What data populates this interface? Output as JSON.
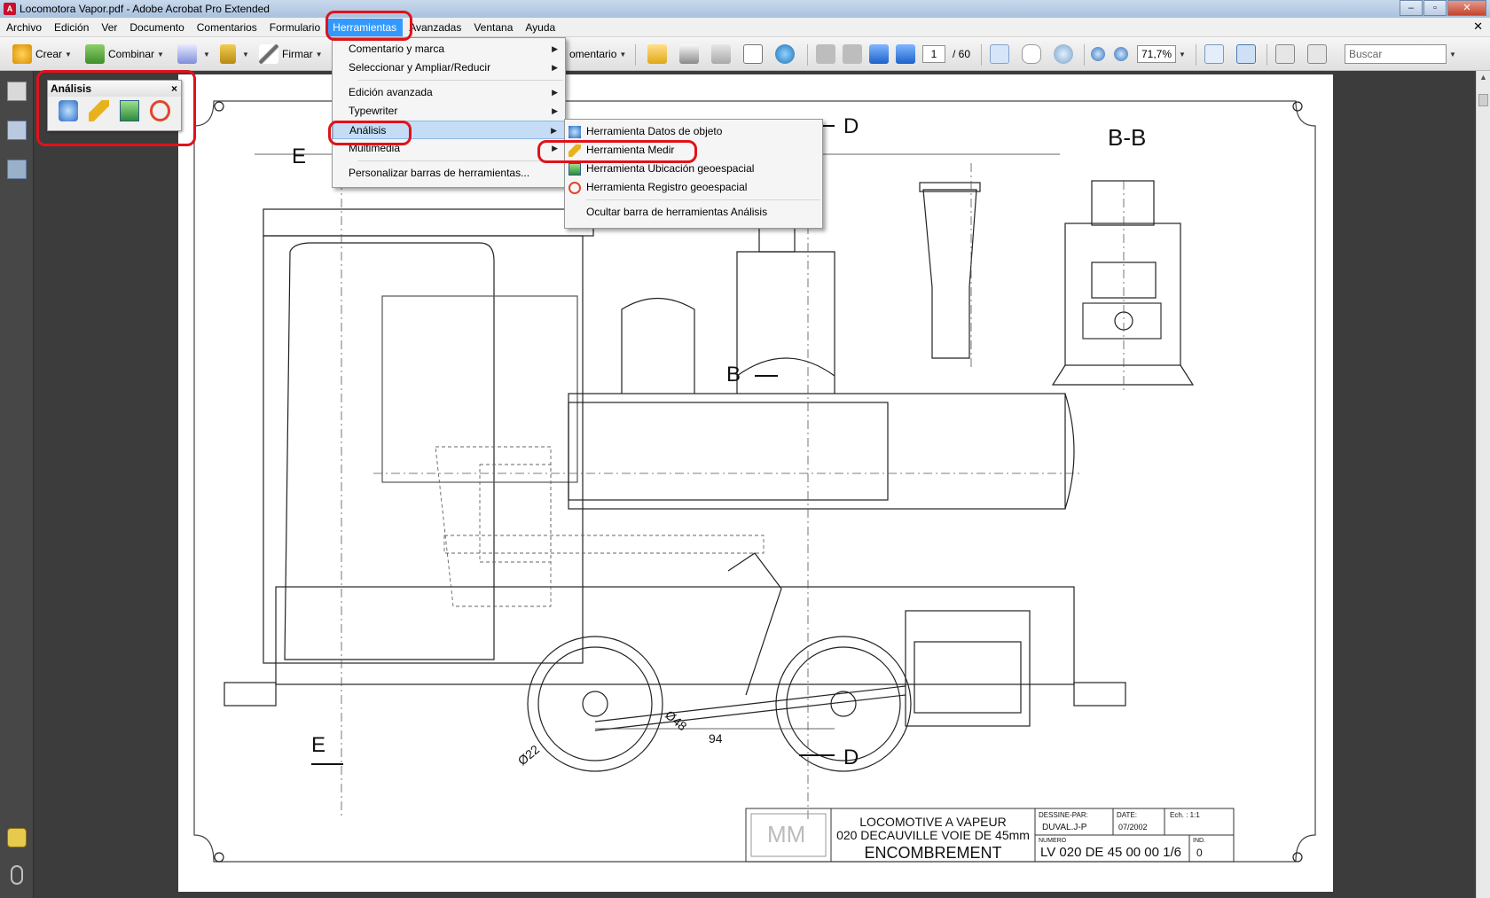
{
  "window": {
    "title": "Locomotora Vapor.pdf - Adobe Acrobat Pro Extended"
  },
  "menubar": {
    "items": [
      "Archivo",
      "Edición",
      "Ver",
      "Documento",
      "Comentarios",
      "Formulario",
      "Herramientas",
      "Avanzadas",
      "Ventana",
      "Ayuda"
    ],
    "active": "Herramientas"
  },
  "toolbar": {
    "crear": "Crear",
    "combinar": "Combinar",
    "firmar": "Firmar",
    "comentario_partial": "omentario",
    "page_current": "1",
    "page_total": "/ 60",
    "zoom": "71,7%",
    "search_placeholder": "Buscar"
  },
  "analysis_panel": {
    "title": "Análisis",
    "close": "×",
    "tools": [
      "object-data-tool-icon",
      "measure-tool-icon",
      "geospatial-location-tool-icon",
      "geo-registration-tool-icon"
    ]
  },
  "tools_menu": {
    "items": [
      {
        "label": "Comentario y marca",
        "submenu": true
      },
      {
        "label": "Seleccionar y Ampliar/Reducir",
        "submenu": true
      },
      {
        "label": "Edición avanzada",
        "submenu": true
      },
      {
        "label": "Typewriter",
        "submenu": true
      },
      {
        "label": "Análisis",
        "submenu": true
      },
      {
        "label": "Multimedia",
        "submenu": true
      },
      {
        "label": "Personalizar barras de herramientas...",
        "submenu": false
      }
    ]
  },
  "analysis_submenu": {
    "items": [
      {
        "label": "Herramienta Datos de objeto"
      },
      {
        "label": "Herramienta Medir"
      },
      {
        "label": "Herramienta Ubicación geoespacial"
      },
      {
        "label": "Herramienta Registro geoespacial"
      },
      {
        "label": "Ocultar barra de herramientas Análisis"
      }
    ]
  },
  "drawing": {
    "label_d_top": "D",
    "label_d_bottom": "D",
    "label_e_top": "E",
    "label_e_bottom": "E",
    "label_bb": "B-B",
    "label_b": "B",
    "dim_94": "94",
    "dim_22": "Ø22",
    "dim_48": "Ø48"
  },
  "title_block": {
    "line1": "LOCOMOTIVE A VAPEUR",
    "line2": "020 DECAUVILLE VOIE DE 45mm",
    "line3": "ENCOMBREMENT",
    "dessine_label": "DESSINE-PAR:",
    "dessine_value": "DUVAL.J-P",
    "date_label": "DATE:",
    "date_value": "07/2002",
    "echelle": "Ech. : 1:1",
    "numero_label": "NUMERO",
    "numero_value": "LV 020 DE 45 00 00 1/6",
    "ind_label": "IND.",
    "ind_value": "0"
  },
  "colors": {
    "highlight": "#e0121a",
    "menu_active": "#3399ff",
    "doc_bg": "#3c3c3c"
  }
}
